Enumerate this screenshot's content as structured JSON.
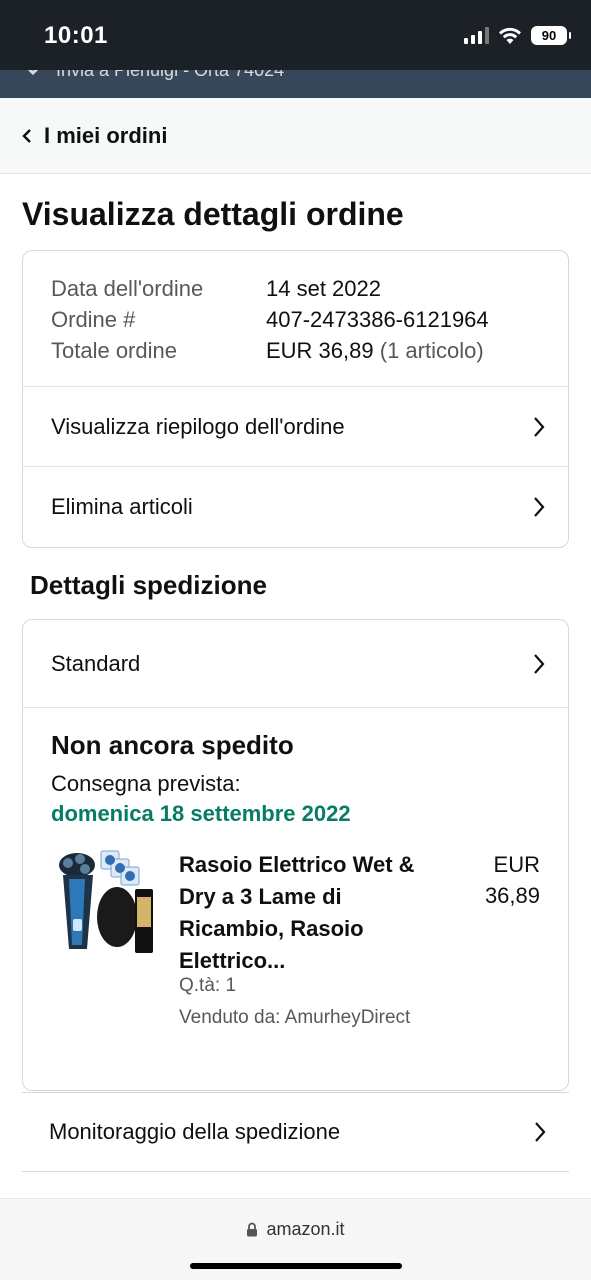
{
  "status_bar": {
    "time": "10:01",
    "battery": "90"
  },
  "header_strip": {
    "text": "Invia a Pierluigi - Orta 74024"
  },
  "back_nav": {
    "label": "I miei ordini"
  },
  "page_title": "Visualizza dettagli ordine",
  "order_info": {
    "date_label": "Data dell'ordine",
    "date_value": "14 set 2022",
    "number_label": "Ordine #",
    "number_value": "407-2473386-6121964",
    "total_label": "Totale ordine",
    "total_value": "EUR 36,89",
    "total_items": "(1 articolo)"
  },
  "order_links": {
    "summary": "Visualizza riepilogo dell'ordine",
    "delete_items": "Elimina articoli"
  },
  "shipping_section_title": "Dettagli spedizione",
  "shipping": {
    "method": "Standard",
    "status": "Non ancora spedito",
    "eta_label": "Consegna prevista:",
    "eta_date": "domenica 18 settembre 2022",
    "eta_color": "#067d62"
  },
  "product": {
    "name": "Rasoio Elettrico Wet & Dry a 3 Lame di Ricambio, Rasoio Elettrico...",
    "price_currency": "EUR",
    "price_amount": "36,89",
    "quantity": "Q.tà: 1",
    "seller": "Venduto da: AmurheyDirect"
  },
  "tracking": {
    "label": "Monitoraggio della spedizione"
  },
  "browser": {
    "url": "amazon.it"
  }
}
